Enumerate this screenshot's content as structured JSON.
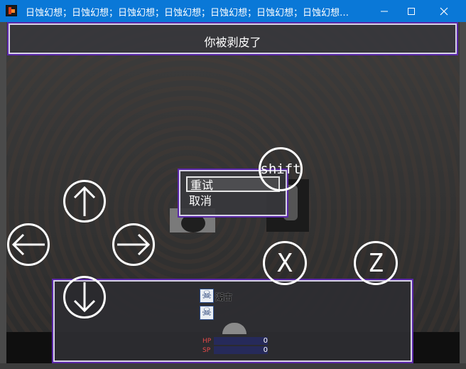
{
  "window": {
    "title": "日蚀幻想；日蚀幻想；日蚀幻想；日蚀幻想；日蚀幻想；日蚀幻想；日蚀幻想；日蚀...",
    "minimize_icon": "minimize-icon",
    "maximize_icon": "maximize-icon",
    "close_icon": "close-icon"
  },
  "message": {
    "text": "你被剥皮了"
  },
  "choices": [
    {
      "label": "重试",
      "selected": true
    },
    {
      "label": "取消",
      "selected": false
    }
  ],
  "status": {
    "actor_name": "湖古",
    "state_icons": [
      "skull-icon",
      "skull-icon"
    ],
    "hp_label": "HP",
    "hp_value": "0",
    "sp_label": "SP",
    "sp_value": "0"
  },
  "virtual_controls": {
    "up_icon": "arrow-up-icon",
    "down_icon": "arrow-down-icon",
    "left_icon": "arrow-left-icon",
    "right_icon": "arrow-right-icon",
    "shift_label": "shift",
    "x_label": "X",
    "z_label": "Z"
  },
  "colors": {
    "titlebar": "#0a78d7",
    "window_border": "#5a27a8",
    "hp_label": "#e84a4a"
  }
}
